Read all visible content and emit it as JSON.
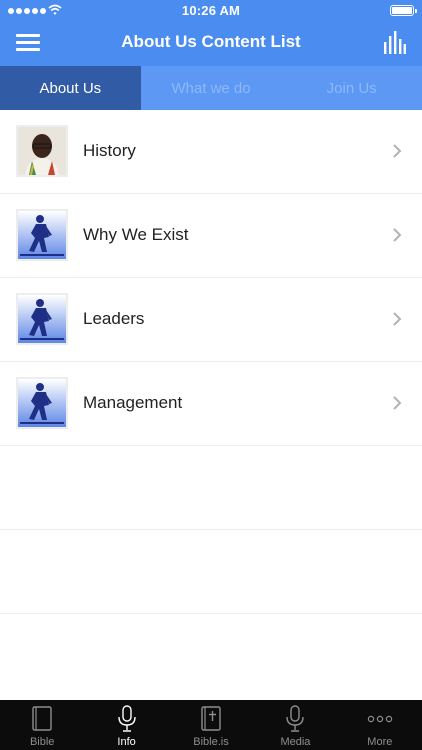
{
  "status_bar": {
    "time": "10:26 AM"
  },
  "nav": {
    "title": "About Us Content List"
  },
  "tabs": [
    {
      "label": "About Us",
      "active": true
    },
    {
      "label": "What we do",
      "active": false
    },
    {
      "label": "Join Us",
      "active": false
    }
  ],
  "list": [
    {
      "label": "History",
      "thumb": "photo-of-man-avatar"
    },
    {
      "label": "Why We Exist",
      "thumb": "hiker-logo-thumbnail"
    },
    {
      "label": "Leaders",
      "thumb": "hiker-logo-thumbnail"
    },
    {
      "label": "Management",
      "thumb": "hiker-logo-thumbnail"
    }
  ],
  "tabbar": [
    {
      "label": "Bible",
      "icon": "book-icon",
      "active": false
    },
    {
      "label": "Info",
      "icon": "microphone-icon",
      "active": true
    },
    {
      "label": "Bible.is",
      "icon": "bible-cross-icon",
      "active": false
    },
    {
      "label": "Media",
      "icon": "microphone-icon",
      "active": false
    },
    {
      "label": "More",
      "icon": "more-dots-icon",
      "active": false
    }
  ],
  "colors": {
    "header_blue": "#4a8cf0",
    "tab_active": "#315ba5",
    "tab_inactive_bg": "#5e98f5",
    "tabbar_bg": "#0c0c0c"
  }
}
